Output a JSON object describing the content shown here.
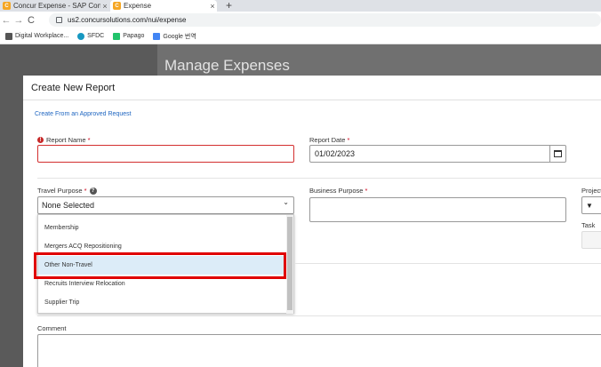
{
  "browser": {
    "tabs": [
      {
        "icon": "concur-icon",
        "title": "Concur Expense - SAP Concur",
        "close": "×"
      },
      {
        "icon": "concur-icon",
        "title": "Expense",
        "close": "×"
      }
    ],
    "new_tab": "+",
    "url": "us2.concursolutions.com/nui/expense",
    "nav": {
      "back": "←",
      "forward": "→",
      "reload": "C"
    },
    "bookmarks": [
      {
        "label": "Digital Workplace...",
        "icon": "apps-grid-icon"
      },
      {
        "label": "SFDC",
        "icon": "cloud-icon"
      },
      {
        "label": "Papago",
        "icon": "papago-icon"
      },
      {
        "label": "Google 번역",
        "icon": "translate-icon"
      }
    ]
  },
  "page": {
    "title": "Manage Expenses"
  },
  "modal": {
    "title": "Create New Report",
    "link_approved": "Create From an Approved Request",
    "report_name": {
      "label": "Report Name",
      "required_mark": "*",
      "value": "",
      "error_icon": "!"
    },
    "report_date": {
      "label": "Report Date",
      "required_mark": "*",
      "value": "01/02/2023"
    },
    "travel_purpose": {
      "label": "Travel Purpose",
      "required_mark": "*",
      "help_icon": "?",
      "selected": "None Selected",
      "chevron": "⌄"
    },
    "business_purpose": {
      "label": "Business Purpose",
      "required_mark": "*",
      "value": ""
    },
    "project": {
      "label": "Project",
      "filter_icon": "▼",
      "chevron": "⌄"
    },
    "task": {
      "label": "Task"
    },
    "dropdown_options": [
      {
        "label": "Membership"
      },
      {
        "label": "Mergers ACQ Repositioning"
      },
      {
        "label": "Other Non-Travel"
      },
      {
        "label": "Recruits Interview Relocation"
      },
      {
        "label": "Supplier Trip"
      }
    ],
    "comment": {
      "label": "Comment",
      "value": ""
    }
  },
  "colors": {
    "link": "#1f66c1",
    "highlight": "#e00000",
    "error": "#d32f2f",
    "selected_option_bg": "#dcecf8"
  }
}
